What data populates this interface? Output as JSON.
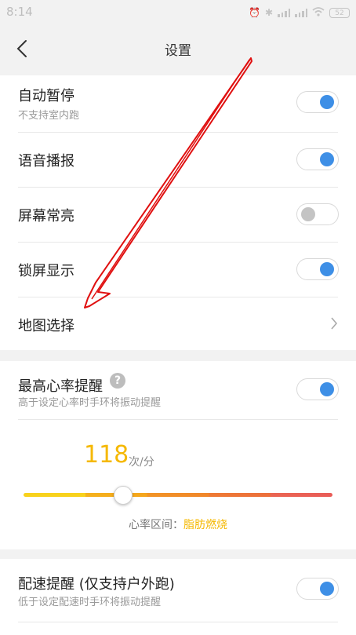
{
  "status_bar": {
    "time": "8:14",
    "battery": "52"
  },
  "header": {
    "title": "设置"
  },
  "settings": [
    {
      "label": "自动暂停",
      "sub": "不支持室内跑",
      "toggle": true
    },
    {
      "label": "语音播报",
      "toggle": true
    },
    {
      "label": "屏幕常亮",
      "toggle": false
    },
    {
      "label": "锁屏显示",
      "toggle": true
    },
    {
      "label": "地图选择"
    }
  ],
  "heart_rate": {
    "label": "最高心率提醒",
    "help_glyph": "?",
    "sub": "高于设定心率时手环将振动提醒",
    "toggle": true,
    "value": "118",
    "unit": "次/分",
    "slider_fraction": 0.32,
    "zone_label": "心率区间：",
    "zone_value": "脂肪燃烧"
  },
  "pace": {
    "label": "配速提醒 (仅支持户外跑)",
    "sub": "低于设定配速时手环将振动提醒",
    "toggle": true
  },
  "colors": {
    "accent_blue": "#3e8fe6",
    "toggle_off": "#c4c4c4",
    "highlight_yellow": "#f5b800",
    "annotation_red": "#e01010"
  },
  "icons": {
    "back": "back-arrow-icon",
    "chevron": "chevron-right-icon",
    "help": "help-icon"
  }
}
